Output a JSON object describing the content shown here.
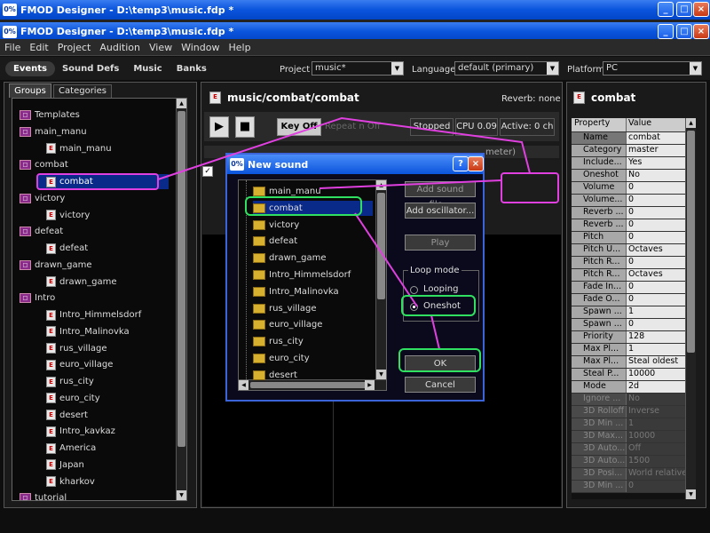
{
  "titlebar": {
    "title": "FMOD Designer - D:\\temp3\\music.fdp *",
    "logo": "0%"
  },
  "titlebar2": {
    "title": "FMOD Designer - D:\\temp3\\music.fdp *"
  },
  "menu": [
    "File",
    "Edit",
    "Project",
    "Audition",
    "View",
    "Window",
    "Help"
  ],
  "top_tabs": [
    "Events",
    "Sound Defs",
    "Music",
    "Banks"
  ],
  "project": {
    "label": "Project",
    "value": "music*"
  },
  "language": {
    "label": "Language",
    "value": "default (primary)"
  },
  "platform": {
    "label": "Platform",
    "value": "PC"
  },
  "left_tabs": [
    "Groups",
    "Categories"
  ],
  "tree": [
    {
      "label": "Templates",
      "type": "folder",
      "depth": 1
    },
    {
      "label": "main_manu",
      "type": "folder",
      "depth": 1
    },
    {
      "label": "main_manu",
      "type": "event",
      "depth": 2
    },
    {
      "label": "combat",
      "type": "folder",
      "depth": 1
    },
    {
      "label": "combat",
      "type": "event",
      "depth": 2,
      "selected": true
    },
    {
      "label": "victory",
      "type": "folder",
      "depth": 1
    },
    {
      "label": "victory",
      "type": "event",
      "depth": 2
    },
    {
      "label": "defeat",
      "type": "folder",
      "depth": 1
    },
    {
      "label": "defeat",
      "type": "event",
      "depth": 2
    },
    {
      "label": "drawn_game",
      "type": "folder",
      "depth": 1
    },
    {
      "label": "drawn_game",
      "type": "event",
      "depth": 2
    },
    {
      "label": "Intro",
      "type": "folder",
      "depth": 1
    },
    {
      "label": "Intro_Himmelsdorf",
      "type": "event",
      "depth": 2
    },
    {
      "label": "Intro_Malinovka",
      "type": "event",
      "depth": 2
    },
    {
      "label": "rus_village",
      "type": "event",
      "depth": 2
    },
    {
      "label": "euro_village",
      "type": "event",
      "depth": 2
    },
    {
      "label": "rus_city",
      "type": "event",
      "depth": 2
    },
    {
      "label": "euro_city",
      "type": "event",
      "depth": 2
    },
    {
      "label": "desert",
      "type": "event",
      "depth": 2
    },
    {
      "label": "Intro_kavkaz",
      "type": "event",
      "depth": 2
    },
    {
      "label": "America",
      "type": "event",
      "depth": 2
    },
    {
      "label": "Japan",
      "type": "event",
      "depth": 2
    },
    {
      "label": "kharkov",
      "type": "event",
      "depth": 2
    },
    {
      "label": "tutorial",
      "type": "folder",
      "depth": 1
    }
  ],
  "editor": {
    "title": "music/combat/combat",
    "reverb": "Reverb: none",
    "keyoff": "Key Off",
    "repeat": "Repeat n Off",
    "stopped": "Stopped",
    "cpu": "CPU 0.09",
    "active": "Active: 0 ch",
    "meter": "meter)"
  },
  "dialog": {
    "title": "New sound",
    "items": [
      "main_manu",
      "combat",
      "victory",
      "defeat",
      "drawn_game",
      "Intro_Himmelsdorf",
      "Intro_Malinovka",
      "rus_village",
      "euro_village",
      "rus_city",
      "euro_city",
      "desert"
    ],
    "add_file": "Add sound file...",
    "add_osc": "Add oscillator...",
    "play": "Play",
    "loop_mode": "Loop mode",
    "looping": "Looping",
    "oneshot": "Oneshot",
    "ok": "OK",
    "cancel": "Cancel"
  },
  "properties": {
    "title": "combat",
    "col_property": "Property",
    "col_value": "Value",
    "rows": [
      {
        "k": "Name",
        "v": "combat",
        "hl": true
      },
      {
        "k": "Category",
        "v": "master"
      },
      {
        "k": "Include...",
        "v": "Yes"
      },
      {
        "k": "Oneshot",
        "v": "No"
      },
      {
        "k": "Volume",
        "v": "0"
      },
      {
        "k": "Volume...",
        "v": "0"
      },
      {
        "k": "Reverb ...",
        "v": "0"
      },
      {
        "k": "Reverb ...",
        "v": "0"
      },
      {
        "k": "Pitch",
        "v": "0"
      },
      {
        "k": "Pitch U...",
        "v": "Octaves"
      },
      {
        "k": "Pitch R...",
        "v": "0"
      },
      {
        "k": "Pitch R...",
        "v": "Octaves"
      },
      {
        "k": "Fade In...",
        "v": "0"
      },
      {
        "k": "Fade O...",
        "v": "0"
      },
      {
        "k": "Spawn ...",
        "v": "1"
      },
      {
        "k": "Spawn ...",
        "v": "0"
      },
      {
        "k": "Priority",
        "v": "128"
      },
      {
        "k": "Max Pl...",
        "v": "1"
      },
      {
        "k": "Max Pl...",
        "v": "Steal oldest"
      },
      {
        "k": "Steal P...",
        "v": "10000"
      },
      {
        "k": "Mode",
        "v": "2d"
      },
      {
        "k": "Ignore ...",
        "v": "No",
        "dis": true
      },
      {
        "k": "3D Rolloff",
        "v": "Inverse",
        "dis": true
      },
      {
        "k": "3D Min ...",
        "v": "1",
        "dis": true
      },
      {
        "k": "3D Max...",
        "v": "10000",
        "dis": true
      },
      {
        "k": "3D Auto...",
        "v": "Off",
        "dis": true
      },
      {
        "k": "3D Auto...",
        "v": "1500",
        "dis": true
      },
      {
        "k": "3D Posi...",
        "v": "World relative",
        "dis": true
      },
      {
        "k": "3D Min ...",
        "v": "0",
        "dis": true
      }
    ]
  },
  "colors": {
    "annotation_magenta": "#e040e0",
    "annotation_green": "#30e060",
    "selection": "#0a2a8a"
  }
}
